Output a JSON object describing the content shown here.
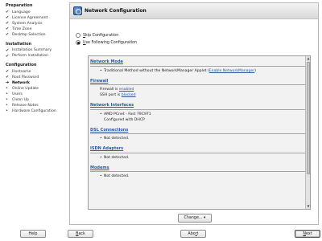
{
  "sidebar": {
    "groups": [
      {
        "title": "Preparation",
        "items": [
          {
            "label": "Language",
            "mark": "✔"
          },
          {
            "label": "License Agreement",
            "mark": "✔"
          },
          {
            "label": "System Analysis",
            "mark": "✔"
          },
          {
            "label": "Time Zone",
            "mark": "✔"
          },
          {
            "label": "Desktop Selection",
            "mark": "✔"
          }
        ]
      },
      {
        "title": "Installation",
        "items": [
          {
            "label": "Installation Summary",
            "mark": "✔"
          },
          {
            "label": "Perform Installation",
            "mark": "✔"
          }
        ]
      },
      {
        "title": "Configuration",
        "items": [
          {
            "label": "Hostname",
            "mark": "✔"
          },
          {
            "label": "Root Password",
            "mark": "✔"
          },
          {
            "label": "Network",
            "mark": "➜"
          },
          {
            "label": "Online Update",
            "mark": "•"
          },
          {
            "label": "Users",
            "mark": "•"
          },
          {
            "label": "Clean Up",
            "mark": "•"
          },
          {
            "label": "Release Notes",
            "mark": "•"
          },
          {
            "label": "Hardware Configuration",
            "mark": "•"
          }
        ]
      }
    ]
  },
  "main": {
    "title": "Network Configuration",
    "options": {
      "skip": {
        "accel": "S",
        "rest": "kip Configuration",
        "selected": false
      },
      "use": {
        "accel": "U",
        "rest": "se Following Configuration",
        "selected": true
      }
    },
    "sections": {
      "network_mode": {
        "title": "Network Mode",
        "line_prefix": "Traditional Method without the NetworkManager Applet (",
        "link": "Enable NetworkManager",
        "line_suffix": ")"
      },
      "firewall": {
        "title": "Firewall",
        "line1_prefix": "Firewall is ",
        "line1_link": "enabled",
        "line2_prefix": "SSH port is ",
        "line2_link": "blocked"
      },
      "interfaces": {
        "title": "Network Interfaces",
        "device": "AMD PCnet - Fast 79C971",
        "config": "Configured with DHCP"
      },
      "dsl": {
        "title": "DSL Connections",
        "status": "Not detected."
      },
      "isdn": {
        "title": "ISDN Adapters",
        "status": "Not detected."
      },
      "modems": {
        "title": "Modems",
        "status": "Not detected."
      }
    },
    "change_button": {
      "label": "Change...",
      "arrow": "▾"
    }
  },
  "footer": {
    "help": "Help",
    "back": {
      "accel": "B",
      "rest": "ack"
    },
    "abort": {
      "pre": "Abo",
      "accel": "r",
      "rest": "t"
    },
    "next": {
      "accel": "N",
      "rest": "ext"
    }
  }
}
